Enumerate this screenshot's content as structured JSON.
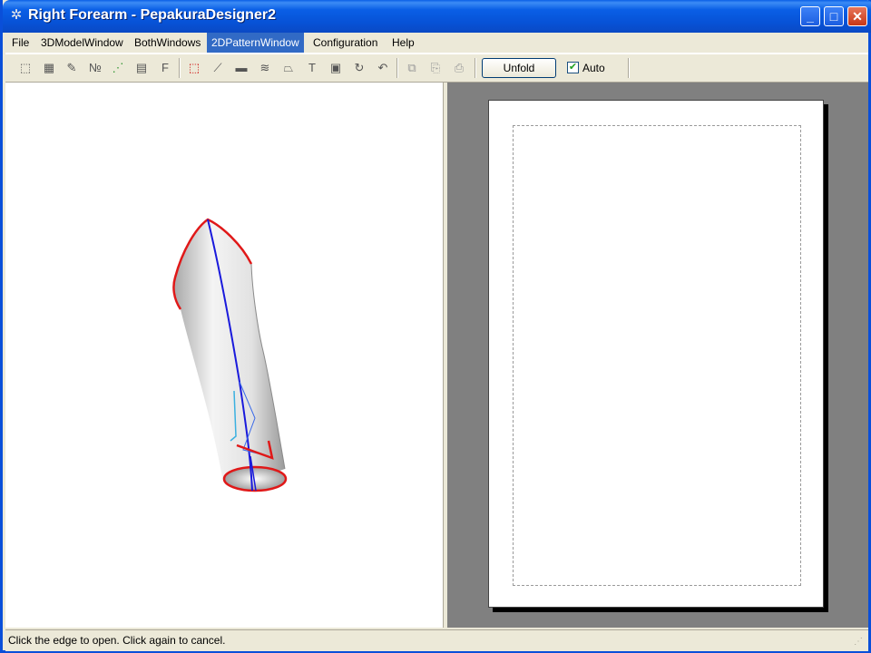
{
  "window": {
    "title": "Right Forearm - PepakuraDesigner2",
    "controls": [
      "minimize",
      "maximize",
      "close"
    ]
  },
  "menu": [
    {
      "label": "File",
      "active": false
    },
    {
      "label": "3DModelWindow",
      "active": false
    },
    {
      "label": "BothWindows",
      "active": false
    },
    {
      "label": "2DPatternWindow",
      "active": true
    },
    {
      "label": "Configuration",
      "active": false
    },
    {
      "label": "Help",
      "active": false
    }
  ],
  "toolbar": {
    "tools": [
      "select-icon",
      "multi-select-icon",
      "pencil-icon",
      "number-icon",
      "dashed-line-icon",
      "page-icon",
      "font-icon",
      "cursor-select-icon",
      "edge-icon",
      "film-icon",
      "fold-lines-icon",
      "flap-icon",
      "text-icon",
      "image-icon",
      "rotate-icon",
      "undo-icon",
      "copy-icon",
      "paste-icon",
      "print-icon"
    ],
    "unfold_label": "Unfold",
    "auto_label": "Auto",
    "auto_checked": true
  },
  "model": {
    "outline_color": "#e01818",
    "edge_color": "#1a1adc",
    "surface_color": "#d8d8d8"
  },
  "status": {
    "text": "Click the edge to open. Click again to cancel."
  }
}
